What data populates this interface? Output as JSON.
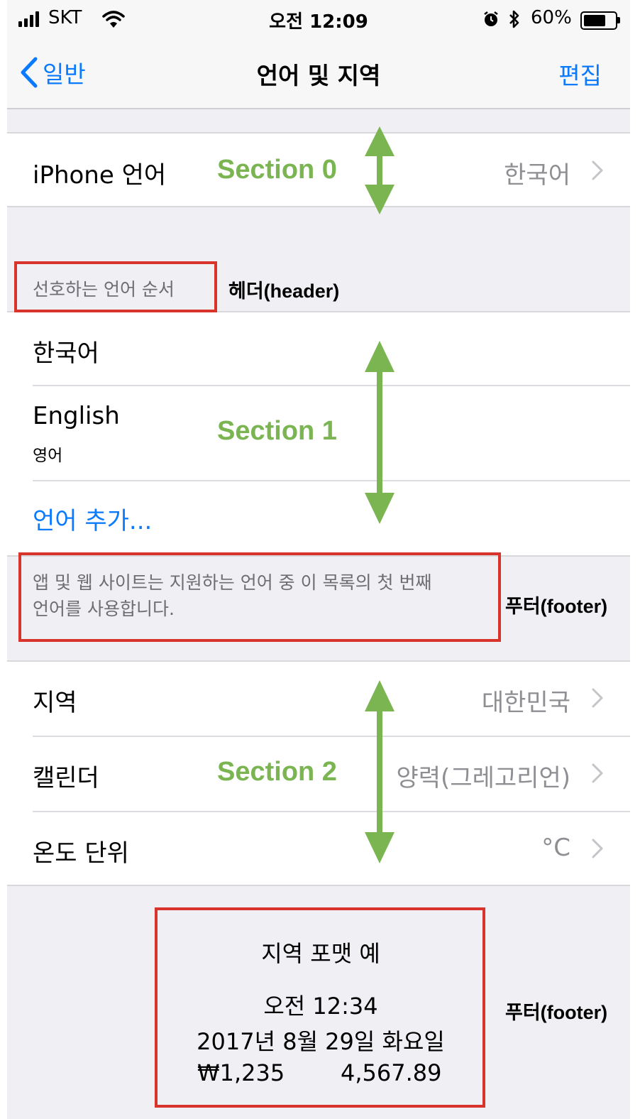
{
  "status_bar": {
    "carrier": "SKT",
    "time": "오전 12:09",
    "battery": "60%"
  },
  "nav": {
    "back_label": "일반",
    "title": "언어 및 지역",
    "edit_label": "편집"
  },
  "section0": {
    "label": "iPhone 언어",
    "value": "한국어"
  },
  "section1": {
    "header": "선호하는 언어 순서",
    "items": [
      {
        "label": "한국어",
        "subtitle": ""
      },
      {
        "label": "English",
        "subtitle": "영어"
      }
    ],
    "add_language": "언어 추가...",
    "footer_line1": "앱 및 웹 사이트는 지원하는 언어 중 이 목록의 첫 번째",
    "footer_line2": "언어를 사용합니다."
  },
  "section2": {
    "rows": [
      {
        "label": "지역",
        "value": "대한민국"
      },
      {
        "label": "캘린더",
        "value": "양력(그레고리언)"
      },
      {
        "label": "온도 단위",
        "value": "°C"
      }
    ]
  },
  "format_example": {
    "title": "지역 포맷 예",
    "time": "오전 12:34",
    "date": "2017년 8월 29일 화요일",
    "currency": "₩1,235",
    "number": "4,567.89"
  },
  "annotations": {
    "section0": "Section 0",
    "section1": "Section 1",
    "section2": "Section 2",
    "header": "헤더(header)",
    "footer1": "푸터(footer)",
    "footer2": "푸터(footer)"
  },
  "colors": {
    "ios_blue": "#0a7aff",
    "annotation_green": "#7ab552",
    "annotation_red": "#d9342b",
    "grouped_background": "#efeff4"
  }
}
